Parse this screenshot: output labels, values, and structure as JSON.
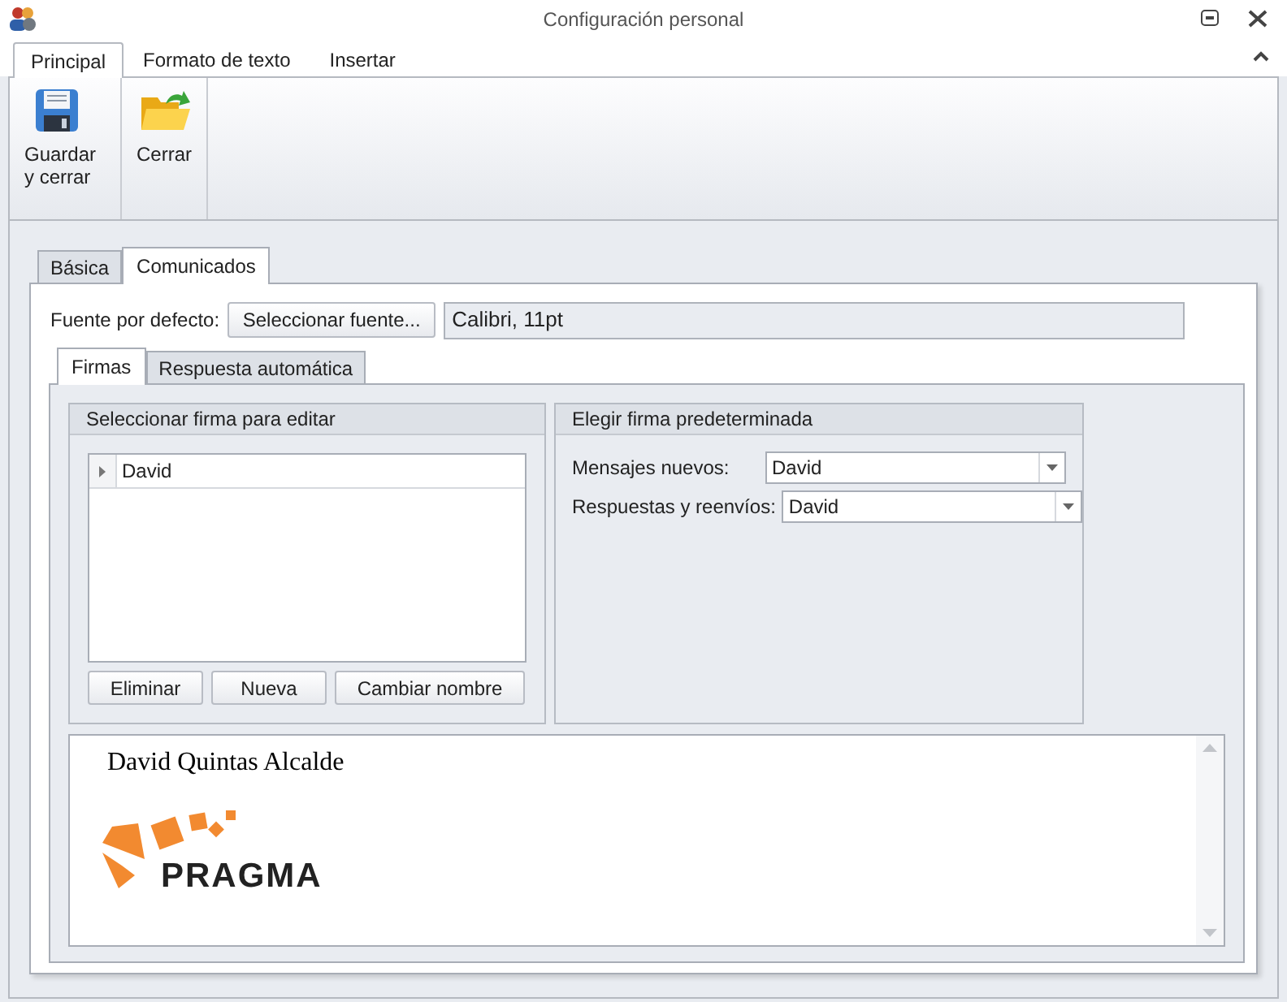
{
  "window": {
    "title": "Configuración personal"
  },
  "ribbon": {
    "tabs": [
      {
        "label": "Principal",
        "selected": true
      },
      {
        "label": "Formato de texto",
        "selected": false
      },
      {
        "label": "Insertar",
        "selected": false
      }
    ],
    "buttons": [
      {
        "kind": "save",
        "label": "Guardar y cerrar"
      },
      {
        "kind": "close",
        "label": "Cerrar"
      }
    ]
  },
  "tabs": [
    {
      "label": "Básica",
      "selected": false
    },
    {
      "label": "Comunicados",
      "selected": true
    }
  ],
  "default_font": {
    "label": "Fuente por defecto:",
    "button": "Seleccionar fuente...",
    "value": "Calibri, 11pt"
  },
  "subtabs": [
    {
      "label": "Firmas",
      "selected": true
    },
    {
      "label": "Respuesta automática",
      "selected": false
    }
  ],
  "edit_group": {
    "title": "Seleccionar firma para editar",
    "rows": [
      {
        "name": "David",
        "selected": true
      }
    ],
    "buttons": [
      "Eliminar",
      "Nueva",
      "Cambiar nombre"
    ]
  },
  "default_group": {
    "title": "Elegir firma predeterminada",
    "fields": [
      {
        "label": "Mensajes nuevos:",
        "value": "David"
      },
      {
        "label": "Respuestas y reenvíos:",
        "value": "David"
      }
    ]
  },
  "preview": {
    "name": "David Quintas Alcalde",
    "logo_text": "PRAGMA"
  }
}
